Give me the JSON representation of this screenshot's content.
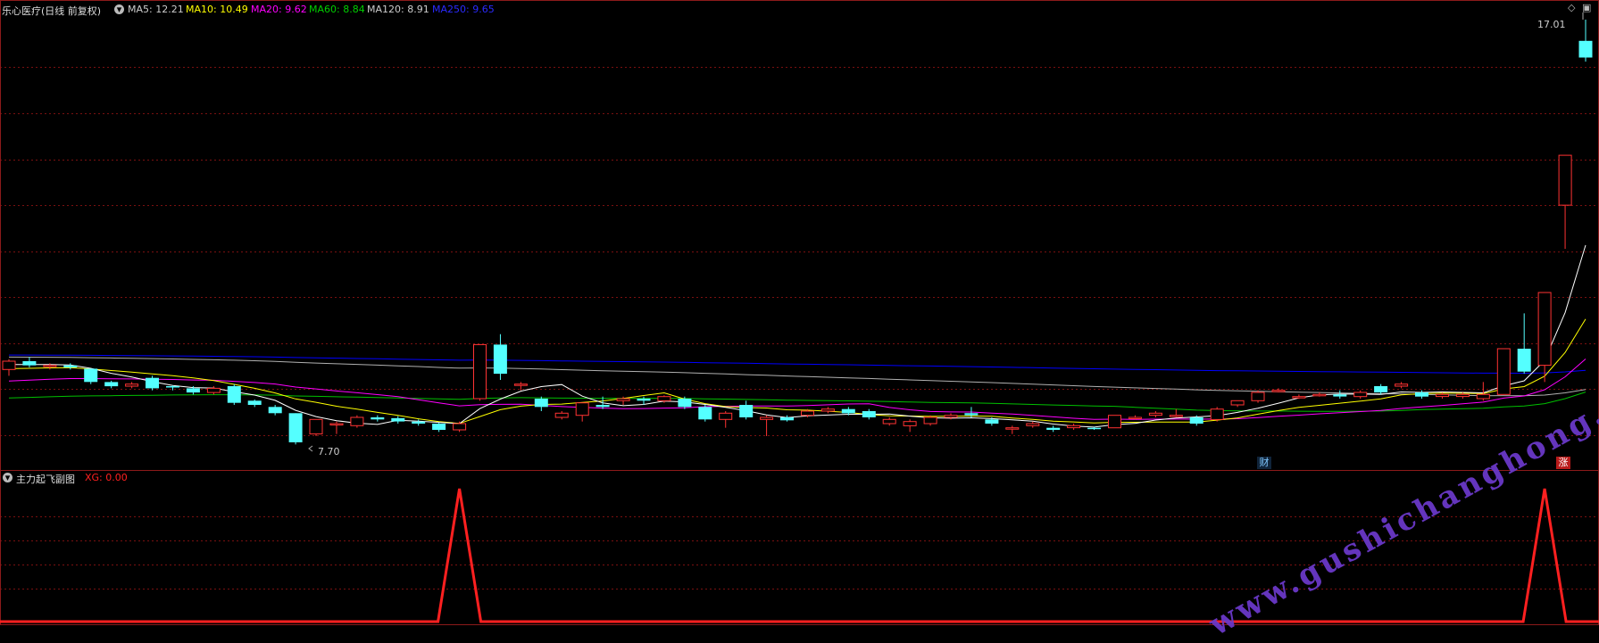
{
  "header": {
    "title": "乐心医疗(日线 前复权)",
    "ma5": "MA5: 12.21",
    "ma10": "MA10: 10.49",
    "ma20": "MA20: 9.62",
    "ma60": "MA60: 8.84",
    "ma120": "MA120: 8.91",
    "ma250": "MA250: 9.65"
  },
  "colors": {
    "ma5": "#ffffff",
    "ma10": "#ffff00",
    "ma20": "#ff00ff",
    "ma60": "#00c000",
    "ma120": "#b0b0b0",
    "ma250": "#0000ff",
    "up": "#ff3333",
    "down": "#54ffff",
    "grid": "#7a1010",
    "indicator": "#ff2020"
  },
  "price_panel": {
    "high_label": "17.01",
    "low_label": "7.70",
    "badge_cai": "财",
    "badge_zhang": "涨"
  },
  "indicator_panel": {
    "name": "主力起飞副图",
    "xg": "XG: 0.00"
  },
  "watermark": "www.gushichanghong.com",
  "icons": [
    "collapse-icon",
    "diamond-icon",
    "window-icon"
  ],
  "chart_data": {
    "type": "candlestick",
    "ohlc": [
      [
        8.6,
        8.8,
        8.45,
        8.85
      ],
      [
        8.8,
        8.7,
        8.65,
        8.9
      ],
      [
        8.7,
        8.7,
        8.6,
        8.75
      ],
      [
        8.7,
        8.65,
        8.6,
        8.75
      ],
      [
        8.62,
        8.3,
        8.25,
        8.62
      ],
      [
        8.3,
        8.2,
        8.15,
        8.33
      ],
      [
        8.2,
        8.25,
        8.15,
        8.3
      ],
      [
        8.4,
        8.15,
        8.1,
        8.45
      ],
      [
        8.2,
        8.18,
        8.1,
        8.22
      ],
      [
        8.15,
        8.05,
        8.0,
        8.2
      ],
      [
        8.05,
        8.15,
        8.0,
        8.2
      ],
      [
        8.2,
        7.8,
        7.75,
        8.25
      ],
      [
        7.85,
        7.75,
        7.7,
        7.88
      ],
      [
        7.7,
        7.55,
        7.5,
        7.75
      ],
      [
        7.55,
        6.85,
        6.8,
        7.55
      ],
      [
        7.05,
        7.4,
        7.0,
        7.4
      ],
      [
        7.3,
        7.3,
        7.05,
        7.35
      ],
      [
        7.25,
        7.45,
        7.2,
        7.5
      ],
      [
        7.45,
        7.4,
        7.35,
        7.5
      ],
      [
        7.43,
        7.35,
        7.3,
        7.48
      ],
      [
        7.35,
        7.3,
        7.25,
        7.4
      ],
      [
        7.3,
        7.15,
        7.1,
        7.32
      ],
      [
        7.15,
        7.3,
        7.1,
        7.35
      ],
      [
        7.9,
        9.2,
        7.85,
        9.2
      ],
      [
        9.2,
        8.5,
        8.35,
        9.45
      ],
      [
        8.25,
        8.25,
        8.1,
        8.3
      ],
      [
        7.9,
        7.7,
        7.6,
        7.95
      ],
      [
        7.45,
        7.55,
        7.4,
        7.6
      ],
      [
        7.5,
        7.8,
        7.35,
        7.8
      ],
      [
        7.75,
        7.7,
        7.65,
        7.95
      ],
      [
        7.85,
        7.9,
        7.75,
        7.95
      ],
      [
        7.9,
        7.85,
        7.75,
        7.95
      ],
      [
        7.85,
        7.95,
        7.8,
        7.98
      ],
      [
        7.9,
        7.7,
        7.65,
        7.95
      ],
      [
        7.7,
        7.4,
        7.35,
        7.75
      ],
      [
        7.4,
        7.55,
        7.2,
        7.6
      ],
      [
        7.75,
        7.45,
        7.4,
        7.85
      ],
      [
        7.4,
        7.45,
        7.0,
        7.5
      ],
      [
        7.45,
        7.38,
        7.35,
        7.5
      ],
      [
        7.5,
        7.6,
        7.45,
        7.65
      ],
      [
        7.6,
        7.65,
        7.55,
        7.7
      ],
      [
        7.65,
        7.55,
        7.5,
        7.7
      ],
      [
        7.6,
        7.45,
        7.4,
        7.65
      ],
      [
        7.3,
        7.4,
        7.25,
        7.45
      ],
      [
        7.25,
        7.35,
        7.1,
        7.4
      ],
      [
        7.3,
        7.45,
        7.25,
        7.5
      ],
      [
        7.45,
        7.5,
        7.4,
        7.55
      ],
      [
        7.55,
        7.5,
        7.45,
        7.7
      ],
      [
        7.4,
        7.3,
        7.25,
        7.45
      ],
      [
        7.2,
        7.2,
        7.05,
        7.25
      ],
      [
        7.25,
        7.3,
        7.2,
        7.35
      ],
      [
        7.2,
        7.15,
        7.1,
        7.25
      ],
      [
        7.2,
        7.25,
        7.15,
        7.3
      ],
      [
        7.2,
        7.18,
        7.15,
        7.22
      ],
      [
        7.2,
        7.5,
        7.2,
        7.5
      ],
      [
        7.45,
        7.45,
        7.4,
        7.5
      ],
      [
        7.5,
        7.55,
        7.45,
        7.6
      ],
      [
        7.5,
        7.5,
        7.45,
        7.65
      ],
      [
        7.45,
        7.3,
        7.25,
        7.5
      ],
      [
        7.4,
        7.65,
        7.35,
        7.7
      ],
      [
        7.75,
        7.85,
        7.7,
        7.85
      ],
      [
        7.85,
        8.05,
        7.8,
        8.1
      ],
      [
        8.1,
        8.1,
        8.05,
        8.15
      ],
      [
        7.95,
        7.95,
        7.9,
        8.0
      ],
      [
        8.0,
        8.0,
        7.95,
        8.05
      ],
      [
        8.0,
        7.95,
        7.9,
        8.1
      ],
      [
        7.95,
        8.05,
        7.9,
        8.1
      ],
      [
        8.2,
        8.05,
        8.0,
        8.25
      ],
      [
        8.2,
        8.25,
        8.15,
        8.3
      ],
      [
        8.05,
        7.95,
        7.9,
        8.1
      ],
      [
        7.95,
        8.0,
        7.9,
        8.05
      ],
      [
        7.95,
        8.0,
        7.9,
        8.05
      ],
      [
        7.9,
        8.0,
        7.85,
        8.3
      ],
      [
        8.0,
        9.1,
        8.0,
        9.1
      ],
      [
        9.1,
        8.55,
        8.5,
        9.95
      ],
      [
        8.7,
        10.45,
        8.3,
        10.45
      ],
      [
        12.55,
        13.75,
        11.5,
        13.75
      ],
      [
        16.5,
        16.1,
        16.0,
        17.01
      ]
    ],
    "y_marks": [
      "17.01",
      "7.70"
    ],
    "ma_series": [
      "MA5",
      "MA10",
      "MA20",
      "MA60",
      "MA120",
      "MA250"
    ],
    "indicator": {
      "name": "主力起飞副图",
      "xg": 0.0,
      "spike_indices": [
        22,
        75
      ]
    }
  }
}
